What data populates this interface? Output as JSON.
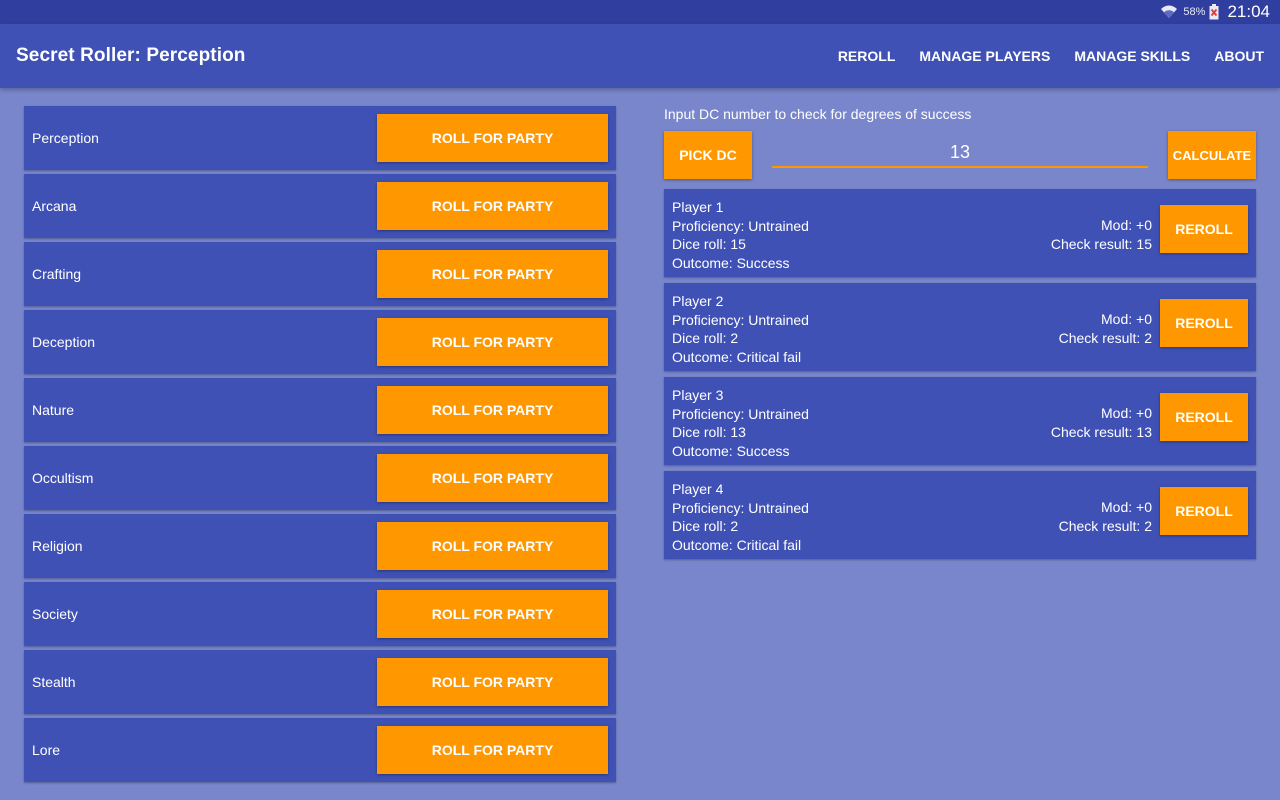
{
  "status_bar": {
    "battery_percent": "58%",
    "time": "21:04",
    "wifi_icon": "wifi-icon",
    "battery_icon": "battery-alert-icon"
  },
  "app_bar": {
    "title": "Secret Roller: Perception",
    "menu": [
      "REROLL",
      "MANAGE PLAYERS",
      "MANAGE SKILLS",
      "ABOUT"
    ]
  },
  "skills": {
    "button_label": "ROLL FOR PARTY",
    "items": [
      "Perception",
      "Arcana",
      "Crafting",
      "Deception",
      "Nature",
      "Occultism",
      "Religion",
      "Society",
      "Stealth",
      "Lore"
    ]
  },
  "dc": {
    "hint": "Input DC number to check for degrees of success",
    "pick_label": "PICK DC",
    "value": "13",
    "calculate_label": "CALCULATE"
  },
  "players": [
    {
      "name": "Player 1",
      "proficiency": "Proficiency: Untrained",
      "dice": "Dice roll: 15",
      "outcome": "Outcome: Success",
      "mod": "Mod: +0",
      "check": "Check result: 15"
    },
    {
      "name": "Player 2",
      "proficiency": "Proficiency: Untrained",
      "dice": "Dice roll: 2",
      "outcome": "Outcome: Critical fail",
      "mod": "Mod: +0",
      "check": "Check result: 2"
    },
    {
      "name": "Player 3",
      "proficiency": "Proficiency: Untrained",
      "dice": "Dice roll: 13",
      "outcome": "Outcome: Success",
      "mod": "Mod: +0",
      "check": "Check result: 13"
    },
    {
      "name": "Player 4",
      "proficiency": "Proficiency: Untrained",
      "dice": "Dice roll: 2",
      "outcome": "Outcome: Critical fail",
      "mod": "Mod: +0",
      "check": "Check result: 2"
    }
  ],
  "reroll_label": "REROLL",
  "colors": {
    "background": "#7986cb",
    "primary": "#3f51b5",
    "primary_dark": "#303f9f",
    "accent": "#ff9800"
  }
}
